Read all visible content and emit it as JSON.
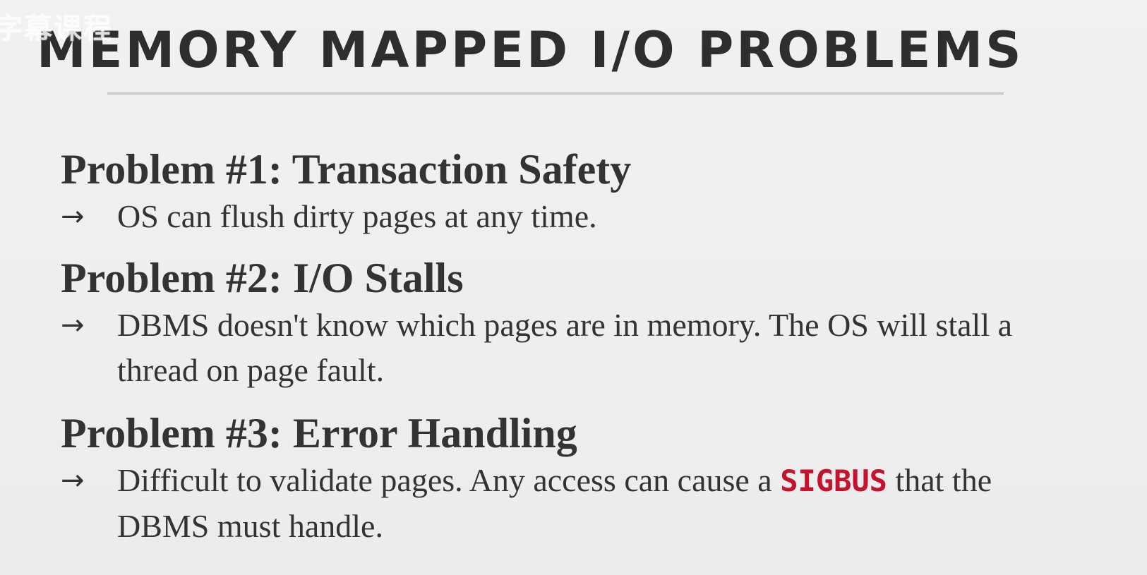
{
  "watermark": "字幕课程",
  "slide": {
    "title": "MEMORY MAPPED I/O PROBLEMS",
    "arrow_symbol": "→",
    "problems": [
      {
        "heading": "Problem #1: Transaction Safety",
        "point": "OS can flush dirty pages at any time."
      },
      {
        "heading": "Problem #2: I/O Stalls",
        "point": "DBMS doesn't know which pages are in memory. The OS will stall a thread on page fault."
      },
      {
        "heading": "Problem #3: Error Handling",
        "point_before": "Difficult to validate pages. Any access can cause a",
        "point_code": "SIGBUS",
        "point_after": "that the DBMS must handle."
      }
    ]
  },
  "colors": {
    "background": "#efefef",
    "text": "#333333",
    "code_highlight": "#c4122f",
    "title_rule": "#c6c6c6"
  }
}
